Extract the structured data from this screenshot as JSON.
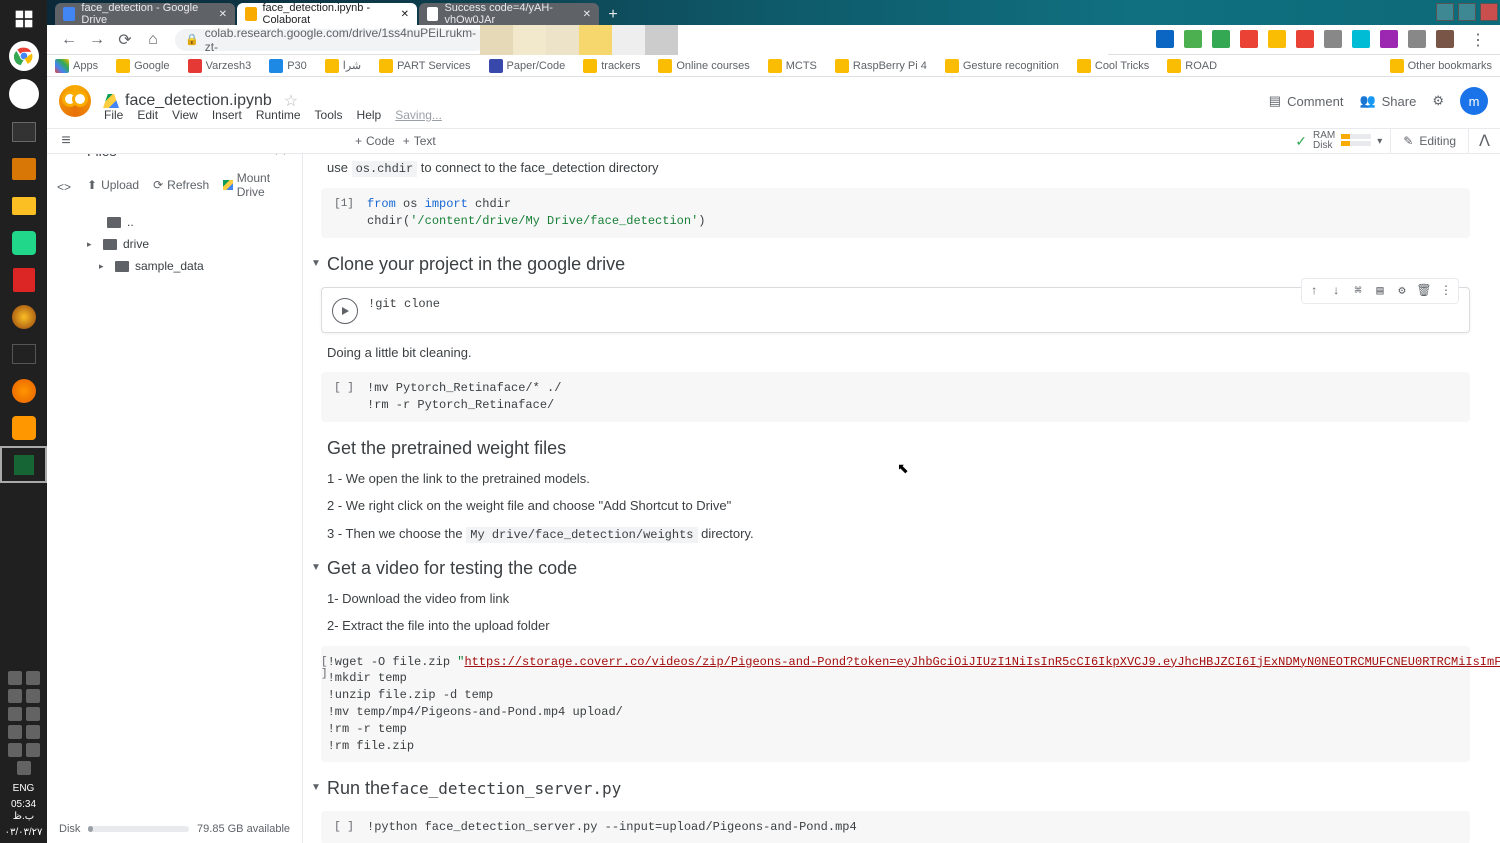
{
  "windows": {
    "lang": "ENG",
    "time": "05:34 ب.ظ",
    "date": "۰۳/۰۳/۲۷"
  },
  "browser": {
    "tabs": [
      {
        "title": "face_detection - Google Drive",
        "active": false
      },
      {
        "title": "face_detection.ipynb - Colaborat",
        "active": true
      },
      {
        "title": "Success code=4/yAH-vhOw0JAr",
        "active": false
      }
    ],
    "url": "colab.research.google.com/drive/1ss4nuPEiLrukm-zt-",
    "bookmarks": [
      "Apps",
      "Google",
      "Varzesh3",
      "P30",
      "شرا",
      "PART Services",
      "Paper/Code",
      "trackers",
      "Online courses",
      "MCTS",
      "RaspBerry Pi 4",
      "Gesture recognition",
      "Cool Tricks",
      "ROAD"
    ],
    "other_bookmarks": "Other bookmarks"
  },
  "colab": {
    "filename": "face_detection.ipynb",
    "menus": [
      "File",
      "Edit",
      "View",
      "Insert",
      "Runtime",
      "Tools",
      "Help"
    ],
    "saving": "Saving...",
    "comment": "Comment",
    "share": "Share",
    "avatar": "m",
    "code_btn": "Code",
    "text_btn": "Text",
    "ram": "RAM",
    "disk": "Disk",
    "editing": "Editing"
  },
  "files": {
    "title": "Files",
    "upload": "Upload",
    "refresh": "Refresh",
    "mount": "Mount Drive",
    "items": [
      {
        "name": "..",
        "indent": 0
      },
      {
        "name": "drive",
        "indent": 0
      },
      {
        "name": "sample_data",
        "indent": 1
      }
    ],
    "disk_label": "Disk",
    "disk_free": "79.85 GB available"
  },
  "nb": {
    "text_chdir_pre": "use ",
    "text_chdir_code": "os.chdir",
    "text_chdir_post": " to connect to the face_detection directory",
    "cell1_num": "[1]",
    "cell1_l1a": "from",
    "cell1_l1b": " os ",
    "cell1_l1c": "import",
    "cell1_l1d": " chdir",
    "cell1_l2a": "chdir(",
    "cell1_l2b": "'/content/drive/My Drive/face_detection'",
    "cell1_l2c": ")",
    "h_clone": "Clone your project in the google drive",
    "cell2_code": "!git clone",
    "text_clean": "Doing a little bit cleaning.",
    "cell3_num": "[ ]",
    "cell3_l1": "!mv Pytorch_Retinaface/* ./",
    "cell3_l2": "!rm -r Pytorch_Retinaface/",
    "h_weights": "Get the pretrained weight files",
    "w1": "1 - We open the link to the pretrained models.",
    "w2": "2 - We right click on the weight file and choose \"Add Shortcut to Drive\"",
    "w3a": "3 - Then we choose the ",
    "w3code": "My drive/face_detection/weights",
    "w3b": " directory.",
    "h_video": "Get a video for testing the code",
    "v1": "1- Download the video from link",
    "v2": "2- Extract the file into the upload folder",
    "cell4_num": "[ ]",
    "cell4_l1a": "!wget -O file.zip ",
    "cell4_l1b": "\"",
    "cell4_url": "https://storage.coverr.co/videos/zip/Pigeons-and-Pond?token=eyJhbGciOiJIUzI1NiIsInR5cCI6IkpXVCJ9.eyJhcHBJZCI6IjExNDMyN0NEOTRCMUFCNEU0RTRCMiIsImFwcElkIjoiNTg1MzA4MjI4MjI1fQ.bo",
    "cell4_l2": "!mkdir temp",
    "cell4_l3": "!unzip file.zip -d temp",
    "cell4_l4": "!mv temp/mp4/Pigeons-and-Pond.mp4 upload/",
    "cell4_l5": "!rm -r temp",
    "cell4_l6": "!rm file.zip",
    "h_run_a": "Run the ",
    "h_run_code": "face_detection_server.py",
    "cell5_num": "[ ]",
    "cell5_l1": "!python face_detection_server.py --input=upload/Pigeons-and-Pond.mp4"
  }
}
